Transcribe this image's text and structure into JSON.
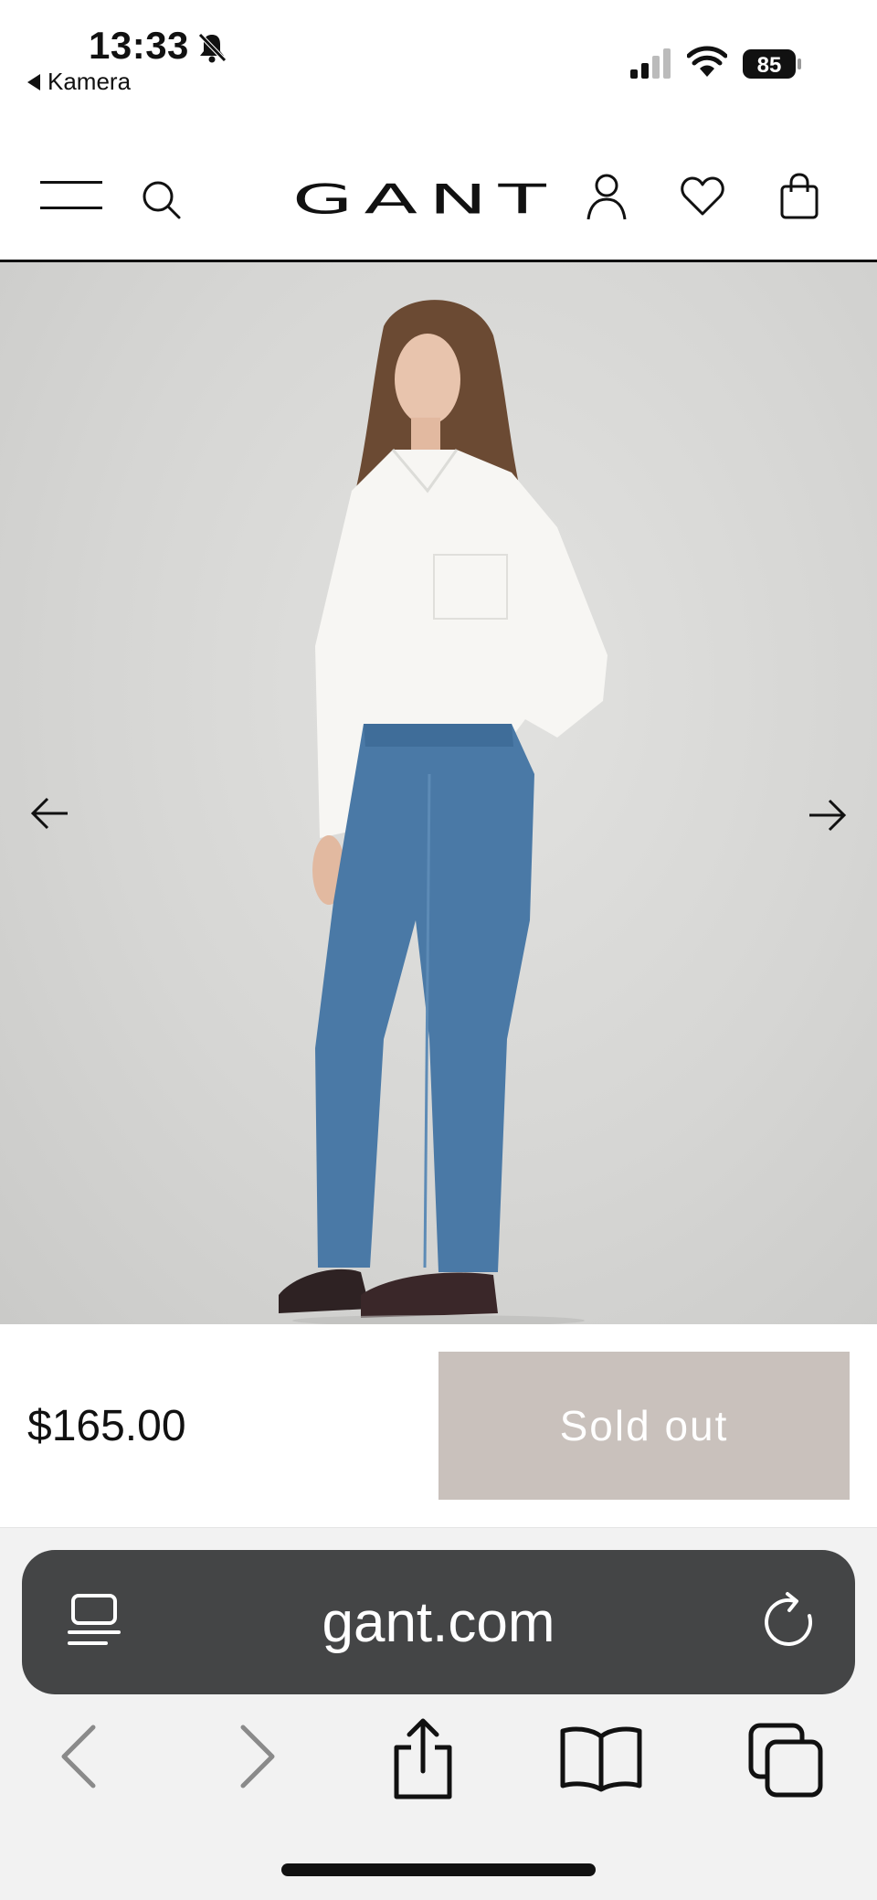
{
  "status_bar": {
    "time": "13:33",
    "back_app": "Kamera",
    "battery": "85"
  },
  "header": {
    "brand": "GANT",
    "icons": [
      "menu-icon",
      "search-icon",
      "user-icon",
      "heart-icon",
      "bag-icon"
    ]
  },
  "product": {
    "price": "$165.00",
    "button_label": "Sold out",
    "button_color": "#c9c1bc"
  },
  "browser": {
    "url": "gant.com",
    "icons": [
      "reader-icon",
      "reload-icon",
      "back-icon",
      "forward-icon",
      "share-icon",
      "bookmarks-icon",
      "tabs-icon"
    ]
  }
}
